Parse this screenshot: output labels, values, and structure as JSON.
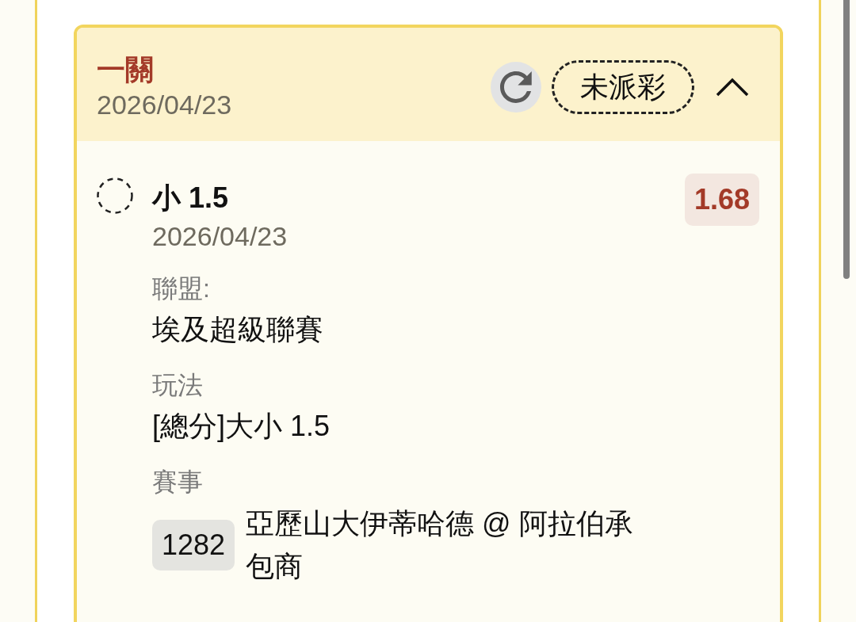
{
  "bet": {
    "type": "一關",
    "date": "2026/04/23",
    "status": {
      "label": "未派彩",
      "settled": false
    },
    "expanded": true,
    "selections": [
      {
        "pick": "小 1.5",
        "date": "2026/04/23",
        "odds": "1.68",
        "settled": false,
        "fields": [
          {
            "kind": "text",
            "label": "聯盟:",
            "value": "埃及超級聯賽"
          },
          {
            "kind": "text",
            "label": "玩法",
            "value": "[總分]大小 1.5"
          },
          {
            "kind": "event",
            "label": "賽事",
            "code": "1282",
            "value": "亞歷山大伊蒂哈德 @ 阿拉伯承包商"
          }
        ]
      }
    ]
  }
}
